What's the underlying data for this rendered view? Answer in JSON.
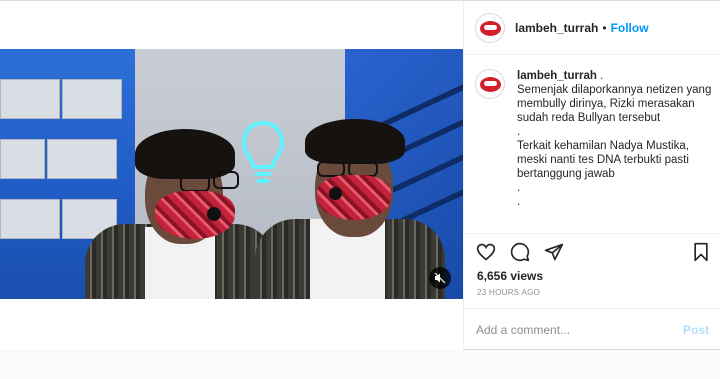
{
  "header": {
    "username": "lambeh_turrah",
    "separator": "•",
    "follow_label": "Follow"
  },
  "caption": {
    "username": "lambeh_turrah",
    "dot": " .",
    "body": "Semenjak dilaporkannya netizen yang membully dirinya, Rizki merasakan sudah reda Bullyan tersebut\n.\nTerkait kehamilan Nadya Mustika, meski nanti tes DNA terbukti pasti bertanggung jawab\n.\n."
  },
  "stats": {
    "views": "6,656 views",
    "time": "23 HOURS AGO"
  },
  "comment": {
    "placeholder": "Add a comment...",
    "post_label": "Post"
  },
  "icons": {
    "like": "heart-icon",
    "comment": "comment-icon",
    "share": "share-icon",
    "save": "bookmark-icon",
    "mute": "mute-icon"
  },
  "colors": {
    "accent": "#0095f6",
    "post_disabled": "#b2dffc",
    "muted_text": "#8e8e8e"
  }
}
